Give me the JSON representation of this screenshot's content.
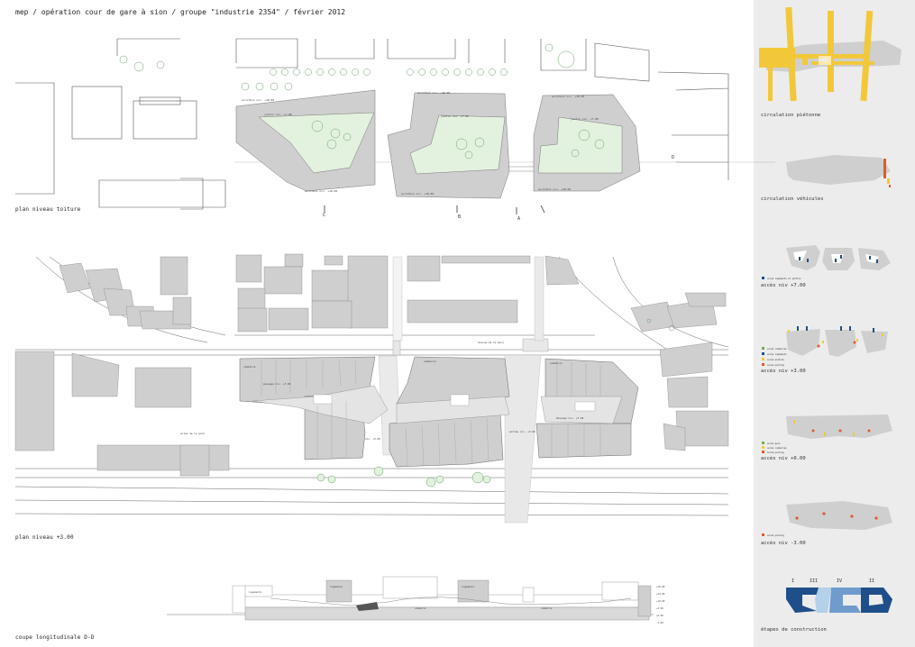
{
  "header": {
    "title": "mep / opération cour de gare à sion / groupe \"industrie 2354\" / février 2012"
  },
  "plans": {
    "roof_caption": "plan niveau toiture",
    "level3_caption": "plan niveau +3.00",
    "section_caption": "coupe longitudinale D-D"
  },
  "section_markers": {
    "c": "C",
    "b": "B",
    "a": "A",
    "d": "D"
  },
  "sidebar": {
    "captions": [
      "circulation piétonne",
      "circulation véhicules",
      "accès niv +7.00",
      "accès niv +3.00",
      "accès niv +0.00",
      "accès niv -3.00",
      "étapes de construction"
    ],
    "etapes": [
      "I",
      "III",
      "IV",
      "II"
    ]
  },
  "colors": {
    "building": "#cfcfcf",
    "courtyard": "#e3f2df",
    "pedestrian": "#f2c83a",
    "vehicle": "#e05a2a",
    "stage_dark": "#1e4f8a",
    "stage_mid": "#6f9ccd",
    "stage_light": "#b4d0ea"
  }
}
